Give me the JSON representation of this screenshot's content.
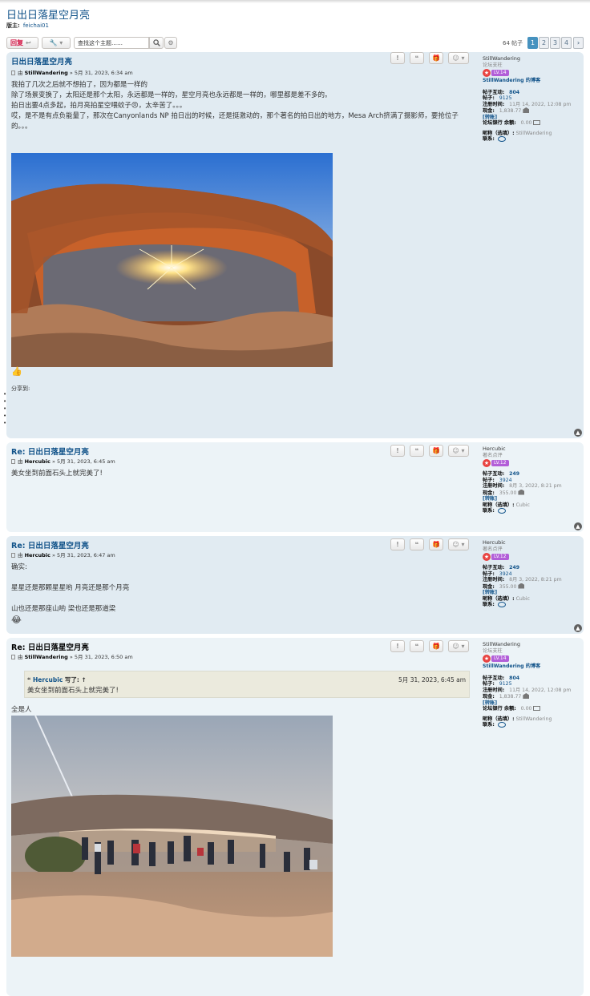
{
  "topic": {
    "title": "日出日落星空月亮",
    "moderators_label": "版主:",
    "moderator": "feichai01"
  },
  "actionbar": {
    "reply_label": "回复",
    "search_placeholder": "查找这个主题……",
    "post_count": "64 帖子",
    "pages": [
      "1",
      "2",
      "3",
      "4"
    ],
    "next_label": "›"
  },
  "post_buttons": {
    "report": "!",
    "quote": "❝",
    "gift": "🎁",
    "more": "☺ ▾"
  },
  "posts": [
    {
      "title": "日出日落星空月亮",
      "by": "由",
      "author": "StillWandering",
      "time": "» 5月 31, 2023, 6:34 am",
      "text": [
        "我拍了几次之后就不想拍了，因为都是一样的",
        "除了场景变换了，太阳还是那个太阳，永远都是一样的，星空月亮也永远都是一样的，哪里都是差不多的。",
        "拍日出要4点多起，拍月亮拍星空喂蚊子😠，太辛苦了。。。",
        "哎，是不是有点负能量了，那次在Canyonlands NP 拍日出的时候，还是挺激动的，那个著名的拍日出的地方，Mesa Arch挤满了摄影师，要抢位子的。。。"
      ],
      "share_label": "分享到:",
      "profile": {
        "username": "StillWandering",
        "rank": "论坛支柱",
        "level": "LV.14",
        "blog": "StillWandering 的博客",
        "interactions_label": "帖子互动:",
        "interactions": "804",
        "posts_label": "帖子:",
        "posts": "9125",
        "joined_label": "注册时间:",
        "joined": "11月 14, 2022, 12:08 pm",
        "cash_label": "现金:",
        "cash": "1,838.77",
        "transfer": "[转账]",
        "bank_label": "论坛银行 余额:",
        "bank": "0.00",
        "nickname_label": "昵称（选填）:",
        "nickname": "StillWandering",
        "contact_label": "联系:"
      }
    },
    {
      "title": "Re: 日出日落星空月亮",
      "by": "由",
      "author": "Hercubic",
      "time": "» 5月 31, 2023, 6:45 am",
      "text": [
        "美女坐到前面石头上就完美了!"
      ],
      "profile": {
        "username": "Hercubic",
        "rank": "著名点评",
        "level": "LV.12",
        "interactions_label": "帖子互动:",
        "interactions": "249",
        "posts_label": "帖子:",
        "posts": "3924",
        "joined_label": "注册时间:",
        "joined": "8月 3, 2022, 8:21 pm",
        "cash_label": "现金:",
        "cash": "355.00",
        "transfer": "[转账]",
        "nickname_label": "昵称（选填）:",
        "nickname": "Cubic",
        "contact_label": "联系:"
      }
    },
    {
      "title": "Re: 日出日落星空月亮",
      "by": "由",
      "author": "Hercubic",
      "time": "» 5月 31, 2023, 6:47 am",
      "text": [
        "确实:",
        "星星还是那颗星星哟 月亮还是那个月亮",
        "山也还是那座山哟 梁也还是那道梁"
      ],
      "profile": {
        "username": "Hercubic",
        "rank": "著名点评",
        "level": "LV.12",
        "interactions_label": "帖子互动:",
        "interactions": "249",
        "posts_label": "帖子:",
        "posts": "3924",
        "joined_label": "注册时间:",
        "joined": "8月 3, 2022, 8:21 pm",
        "cash_label": "现金:",
        "cash": "355.00",
        "transfer": "[转账]",
        "nickname_label": "昵称（选填）:",
        "nickname": "Cubic",
        "contact_label": "联系:"
      }
    },
    {
      "title": "Re: 日出日落星空月亮",
      "by": "由",
      "author": "StillWandering",
      "time": "» 5月 31, 2023, 6:50 am",
      "quote": {
        "author": "Hercubic",
        "wrote": "写了:",
        "arrow": "↑",
        "date": "5月 31, 2023, 6:45 am",
        "text": "美女坐到前面石头上就完美了!"
      },
      "text": [
        "全是人"
      ],
      "profile": {
        "username": "StillWandering",
        "rank": "论坛支柱",
        "level": "LV.14",
        "blog": "StillWandering 的博客",
        "interactions_label": "帖子互动:",
        "interactions": "804",
        "posts_label": "帖子:",
        "posts": "9125",
        "joined_label": "注册时间:",
        "joined": "11月 14, 2022, 12:08 pm",
        "cash_label": "现金:",
        "cash": "1,838.77",
        "transfer": "[转账]",
        "bank_label": "论坛银行 余额:",
        "bank": "0.00",
        "nickname_label": "昵称（选填）:",
        "nickname": "StillWandering",
        "contact_label": "联系:"
      }
    }
  ],
  "colors": {
    "link": "#105289",
    "post_bg_light": "#ecf3f7",
    "post_bg_dark": "#e1ebf2",
    "reply_red": "#d31141",
    "page_active": "#4692bf"
  }
}
